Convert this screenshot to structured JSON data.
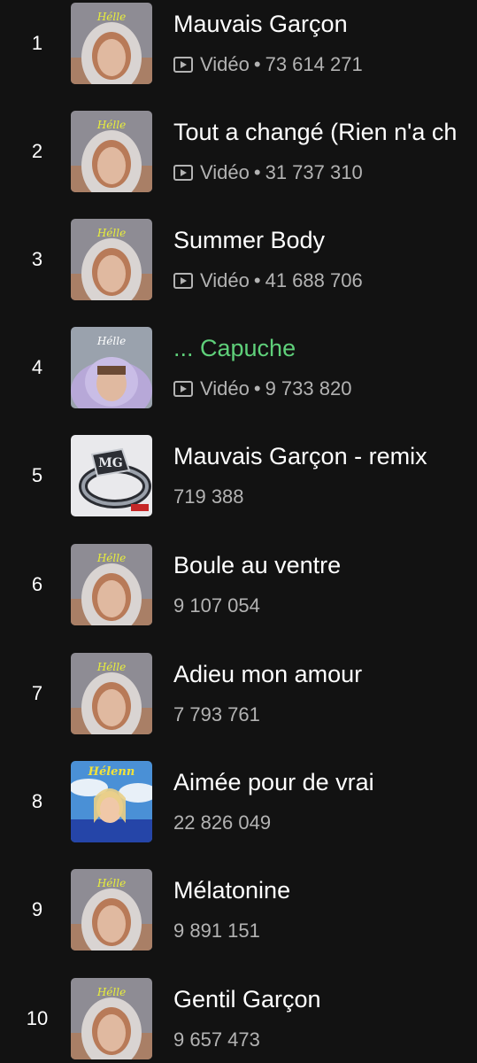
{
  "tracks": [
    {
      "rank": "1",
      "title": "Mauvais Garçon",
      "is_video": true,
      "video_label": "Vidéo",
      "plays": "73 614 271",
      "cover": "hoodie-portrait",
      "playing": false
    },
    {
      "rank": "2",
      "title": "Tout a changé (Rien n'a ch",
      "is_video": true,
      "video_label": "Vidéo",
      "plays": "31 737 310",
      "cover": "hoodie-portrait",
      "playing": false
    },
    {
      "rank": "3",
      "title": "Summer Body",
      "is_video": true,
      "video_label": "Vidéo",
      "plays": "41 688 706",
      "cover": "hoodie-portrait",
      "playing": false
    },
    {
      "rank": "4",
      "title": "... Capuche",
      "is_video": true,
      "video_label": "Vidéo",
      "plays": "9 733 820",
      "cover": "fur-hood-portrait",
      "playing": true
    },
    {
      "rank": "5",
      "title": "Mauvais Garçon - remix",
      "is_video": false,
      "video_label": "",
      "plays": "719 388",
      "cover": "silver-ring",
      "playing": false
    },
    {
      "rank": "6",
      "title": "Boule au ventre",
      "is_video": false,
      "video_label": "",
      "plays": "9 107 054",
      "cover": "hoodie-portrait",
      "playing": false
    },
    {
      "rank": "7",
      "title": "Adieu mon amour",
      "is_video": false,
      "video_label": "",
      "plays": "7 793 761",
      "cover": "hoodie-portrait",
      "playing": false
    },
    {
      "rank": "8",
      "title": "Aimée pour de vrai",
      "is_video": false,
      "video_label": "",
      "plays": "22 826 049",
      "cover": "sky-portrait",
      "playing": false
    },
    {
      "rank": "9",
      "title": "Mélatonine",
      "is_video": false,
      "video_label": "",
      "plays": "9 891 151",
      "cover": "hoodie-portrait",
      "playing": false
    },
    {
      "rank": "10",
      "title": "Gentil Garçon",
      "is_video": false,
      "video_label": "",
      "plays": "9 657 473",
      "cover": "hoodie-portrait",
      "playing": false
    }
  ],
  "colors": {
    "background": "#121212",
    "title": "#ffffff",
    "playing_title": "#5fd07a",
    "secondary": "#b3b3b3"
  }
}
